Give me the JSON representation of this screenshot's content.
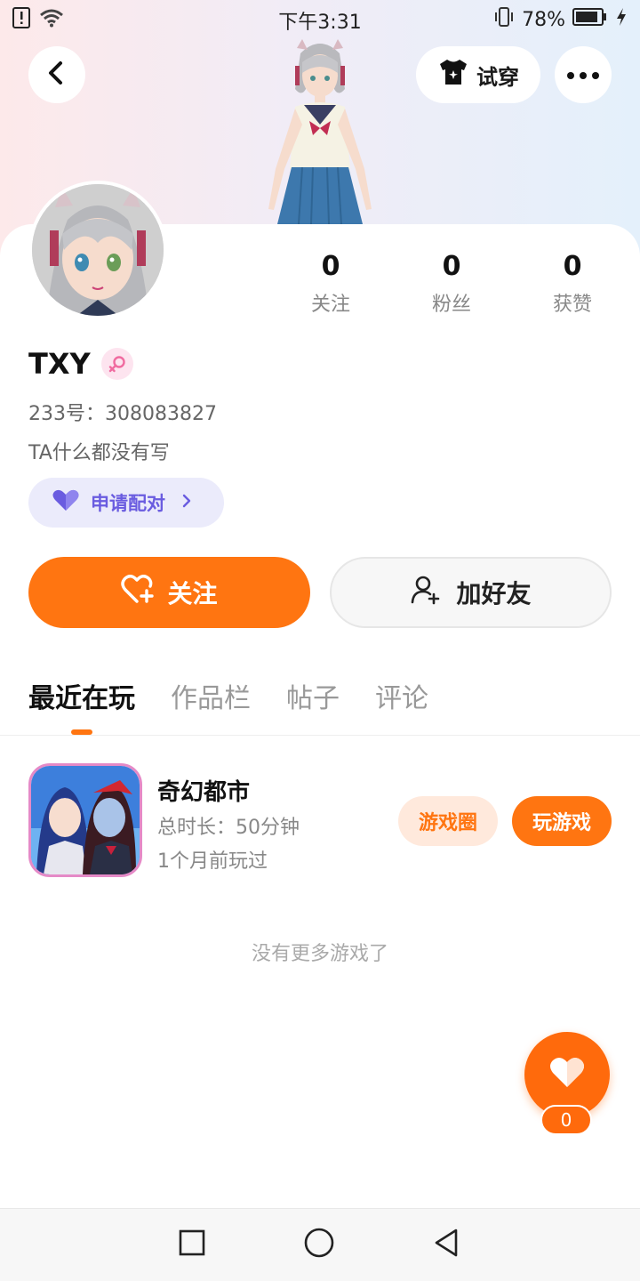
{
  "status_bar": {
    "time": "下午3:31",
    "battery": "78%"
  },
  "header": {
    "tryon_label": "试穿"
  },
  "profile": {
    "name": "TXY",
    "uid": "233号：308083827",
    "bio": "TA什么都没有写",
    "stats": [
      {
        "value": "0",
        "label": "关注"
      },
      {
        "value": "0",
        "label": "粉丝"
      },
      {
        "value": "0",
        "label": "获赞"
      }
    ]
  },
  "actions": {
    "pair_label": "申请配对",
    "follow_label": "关注",
    "add_friend_label": "加好友"
  },
  "tabs": [
    {
      "label": "最近在玩"
    },
    {
      "label": "作品栏"
    },
    {
      "label": "帖子"
    },
    {
      "label": "评论"
    }
  ],
  "games": [
    {
      "title": "奇幻都市",
      "duration": "总时长：50分钟",
      "last_played": "1个月前玩过",
      "circle_label": "游戏圈",
      "play_label": "玩游戏"
    }
  ],
  "list_end_text": "没有更多游戏了",
  "like": {
    "count": "0"
  },
  "colors": {
    "accent": "#ff7511",
    "pair_bg": "#ebebfb",
    "pair_text": "#6a5ce0"
  }
}
